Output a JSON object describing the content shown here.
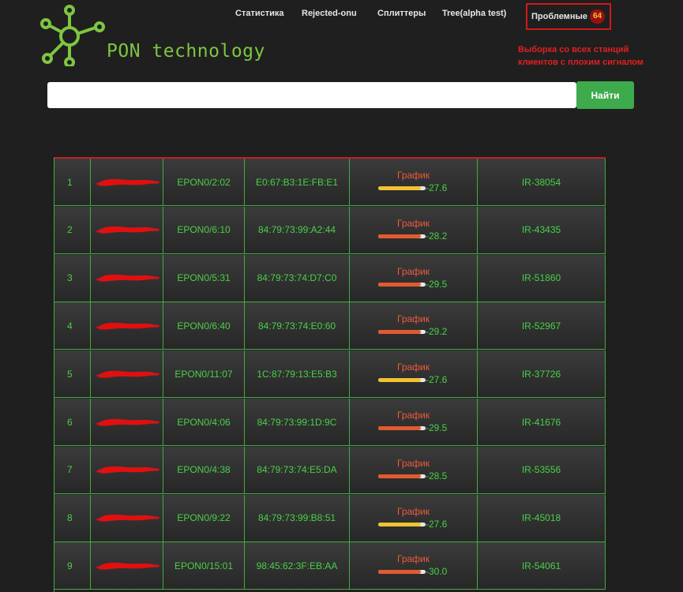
{
  "header": {
    "brand": "PON technology",
    "nav": [
      {
        "label": "Статистика"
      },
      {
        "label": "Rejected-onu"
      },
      {
        "label": "Сплиттеры"
      },
      {
        "label": "Tree(alpha test)"
      }
    ],
    "problem_tab": {
      "label": "Проблемные",
      "count": "64"
    }
  },
  "annotation": {
    "line1": "Выборка со всех станций",
    "line2": "клиентов с плохим сигналом"
  },
  "search": {
    "placeholder": "",
    "button_label": "Найти"
  },
  "colors": {
    "accent_green": "#47d147",
    "button_green": "#3daa4c",
    "alert_red": "#d01818",
    "bar_yellow": "#f1c232",
    "bar_red": "#e25a30"
  },
  "rows": [
    {
      "n": "1",
      "port": "EPON0/2:02",
      "mac": "E0:67:B3:1E:FB:E1",
      "graph": "График",
      "signal": "-27.6",
      "level": 0.9,
      "bar": "yellow",
      "id": "IR-38054"
    },
    {
      "n": "2",
      "port": "EPON0/6:10",
      "mac": "84:79:73:99:A2:44",
      "graph": "График",
      "signal": "-28.2",
      "level": 0.9,
      "bar": "red",
      "id": "IR-43435"
    },
    {
      "n": "3",
      "port": "EPON0/5:31",
      "mac": "84:79:73:74:D7:C0",
      "graph": "График",
      "signal": "-29.5",
      "level": 0.9,
      "bar": "red",
      "id": "IR-51860"
    },
    {
      "n": "4",
      "port": "EPON0/6:40",
      "mac": "84:79:73:74:E0:60",
      "graph": "График",
      "signal": "-29.2",
      "level": 0.9,
      "bar": "red",
      "id": "IR-52967"
    },
    {
      "n": "5",
      "port": "EPON0/11:07",
      "mac": "1C:87:79:13:E5:B3",
      "graph": "График",
      "signal": "-27.6",
      "level": 0.9,
      "bar": "yellow",
      "id": "IR-37726"
    },
    {
      "n": "6",
      "port": "EPON0/4:06",
      "mac": "84:79:73:99:1D:9C",
      "graph": "График",
      "signal": "-29.5",
      "level": 0.9,
      "bar": "red",
      "id": "IR-41676"
    },
    {
      "n": "7",
      "port": "EPON0/4:38",
      "mac": "84:79:73:74:E5:DA",
      "graph": "График",
      "signal": "-28.5",
      "level": 0.9,
      "bar": "red",
      "id": "IR-53556"
    },
    {
      "n": "8",
      "port": "EPON0/9:22",
      "mac": "84:79:73:99:B8:51",
      "graph": "График",
      "signal": "-27.6",
      "level": 0.9,
      "bar": "yellow",
      "id": "IR-45018"
    },
    {
      "n": "9",
      "port": "EPON0/15:01",
      "mac": "98:45:62:3F:EB:AA",
      "graph": "График",
      "signal": "-30.0",
      "level": 0.9,
      "bar": "red",
      "id": "IR-54061"
    }
  ]
}
